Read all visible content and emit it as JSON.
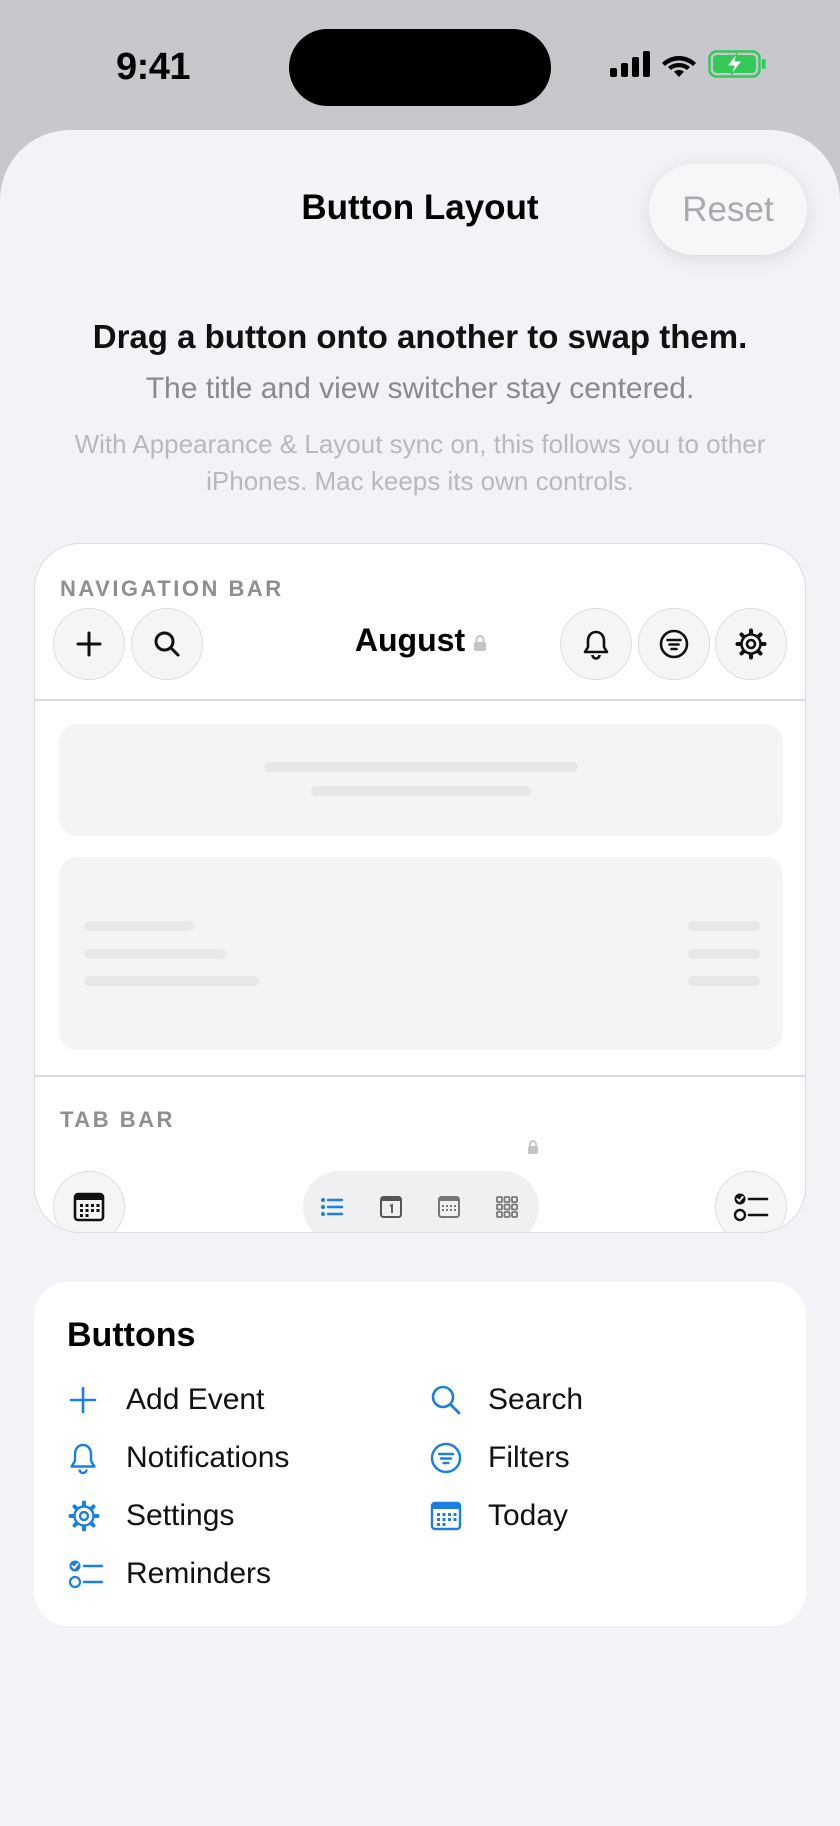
{
  "status_bar": {
    "time": "9:41"
  },
  "sheet": {
    "title": "Button Layout",
    "reset_label": "Reset",
    "hint_main": "Drag a button onto another to swap them.",
    "hint_sub": "The title and view switcher stay centered.",
    "hint_sync": "With Appearance & Layout sync on, this follows you to other iPhones. Mac keeps its own controls."
  },
  "preview": {
    "nav_label": "NAVIGATION BAR",
    "nav_title": "August",
    "tab_label": "TAB BAR"
  },
  "buttons": {
    "title": "Buttons",
    "items": [
      {
        "label": "Add Event",
        "icon": "plus-icon"
      },
      {
        "label": "Search",
        "icon": "search-icon"
      },
      {
        "label": "Notifications",
        "icon": "bell-icon"
      },
      {
        "label": "Filters",
        "icon": "filter-icon"
      },
      {
        "label": "Settings",
        "icon": "gear-icon"
      },
      {
        "label": "Today",
        "icon": "calendar-icon"
      },
      {
        "label": "Reminders",
        "icon": "checklist-icon"
      }
    ]
  },
  "colors": {
    "accent": "#1a7fe0",
    "sheet_bg": "#f2f2f7",
    "battery": "#34c759"
  }
}
